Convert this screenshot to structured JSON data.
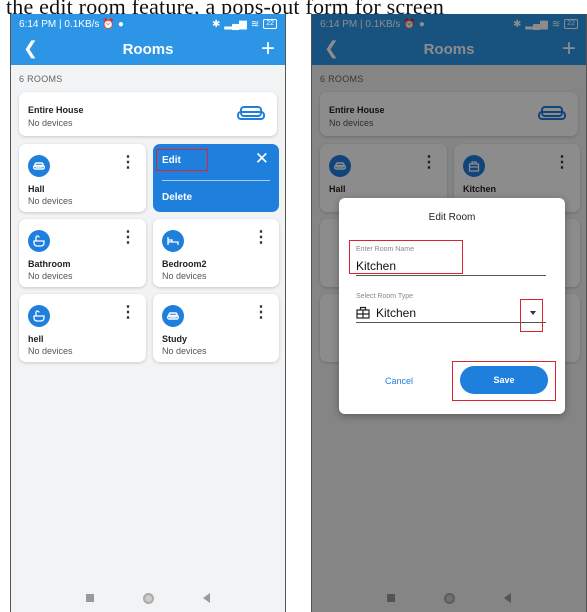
{
  "caption": "the edit room feature, a pops-out form for screen",
  "status": {
    "time_net": "6:14 PM | 0.1KB/s",
    "battery": "22"
  },
  "header": {
    "title": "Rooms"
  },
  "room_count": "6 ROOMS",
  "rooms": [
    {
      "name": "Entire House",
      "status": "No devices",
      "icon": "sofa-icon"
    },
    {
      "name": "Hall",
      "status": "No devices",
      "icon": "sofa-icon"
    },
    {
      "name": "Kitchen",
      "status": "No devices",
      "icon": "kitchen-icon"
    },
    {
      "name": "Bathroom",
      "status": "No devices",
      "icon": "bathtub-icon"
    },
    {
      "name": "Bedroom2",
      "status": "No devices",
      "icon": "bed-icon"
    },
    {
      "name": "hell",
      "status": "No devices",
      "icon": "bathtub-icon"
    },
    {
      "name": "Study",
      "status": "No devices",
      "icon": "sofa-icon"
    }
  ],
  "context_menu": {
    "edit_label": "Edit",
    "delete_label": "Delete"
  },
  "dialog": {
    "title": "Edit Room",
    "name_label": "Enter Room Name",
    "name_value": "Kitchen",
    "type_label": "Select Room Type",
    "type_value": "Kitchen",
    "cancel_label": "Cancel",
    "save_label": "Save"
  },
  "colors": {
    "primary": "#2d95e6",
    "accent": "#1f7fdc",
    "highlight": "#d9262e"
  }
}
